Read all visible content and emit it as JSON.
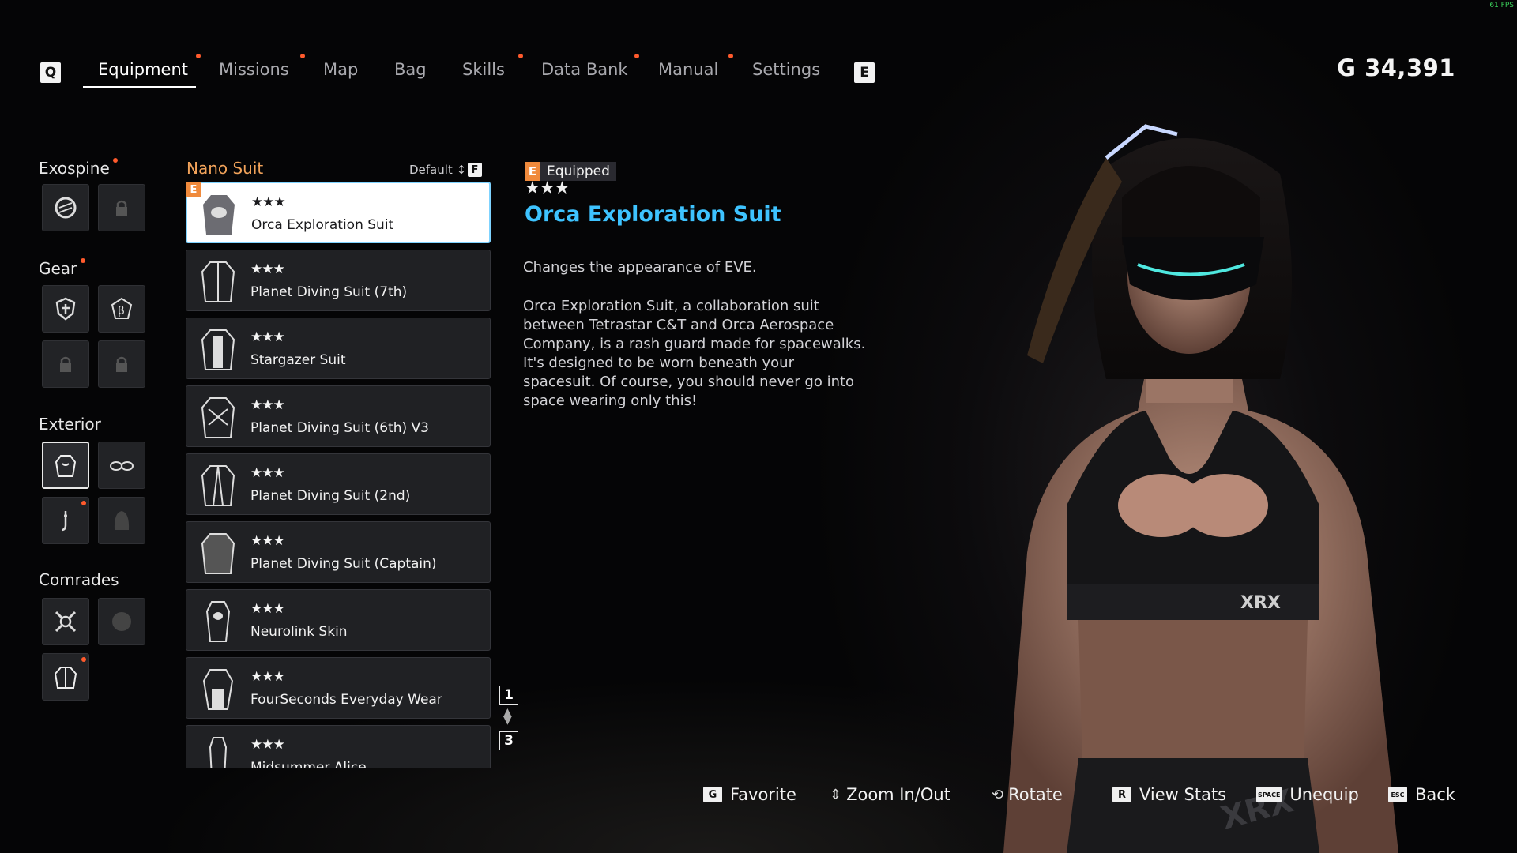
{
  "fps": "61 FPS",
  "nav": {
    "prev_key": "Q",
    "next_key": "E",
    "tabs": [
      {
        "label": "Equipment",
        "active": true,
        "notify": true
      },
      {
        "label": "Missions",
        "notify": true
      },
      {
        "label": "Map"
      },
      {
        "label": "Bag"
      },
      {
        "label": "Skills",
        "notify": true
      },
      {
        "label": "Data Bank",
        "notify": true
      },
      {
        "label": "Manual",
        "notify": true
      },
      {
        "label": "Settings"
      }
    ]
  },
  "currency": {
    "symbol": "G",
    "amount": "34,391"
  },
  "sidebar": {
    "exospine": "Exospine",
    "gear": "Gear",
    "exterior": "Exterior",
    "comrades": "Comrades"
  },
  "list": {
    "title": "Nano Suit",
    "sort_label": "Default",
    "sort_key": "F",
    "equipped_badge": "E",
    "items": [
      {
        "stars": "★★★",
        "name": "Orca Exploration Suit",
        "selected": true,
        "equipped": true
      },
      {
        "stars": "★★★",
        "name": "Planet Diving Suit (7th)"
      },
      {
        "stars": "★★★",
        "name": "Stargazer Suit"
      },
      {
        "stars": "★★★",
        "name": "Planet Diving Suit (6th) V3"
      },
      {
        "stars": "★★★",
        "name": "Planet Diving Suit (2nd)"
      },
      {
        "stars": "★★★",
        "name": "Planet Diving Suit (Captain)"
      },
      {
        "stars": "★★★",
        "name": "Neurolink Skin"
      },
      {
        "stars": "★★★",
        "name": "FourSeconds Everyday Wear"
      },
      {
        "stars": "★★★",
        "name": "Midsummer Alice"
      }
    ]
  },
  "pager": {
    "up": "1",
    "down": "3"
  },
  "detail": {
    "equipped_key": "E",
    "equipped_label": "Equipped",
    "stars": "★★★",
    "name": "Orca Exploration Suit",
    "short": "Changes the appearance of EVE.",
    "description": "Orca Exploration Suit, a collaboration suit between Tetrastar C&T and Orca Aerospace Company, is a rash guard made for spacewalks. It's designed to be worn beneath your spacesuit. Of course, you should never go into space wearing only this!"
  },
  "hints": {
    "favorite_key": "G",
    "favorite": "Favorite",
    "zoom": "Zoom In/Out",
    "rotate": "Rotate",
    "stats_key": "R",
    "stats": "View Stats",
    "unequip_key": "SPACE",
    "unequip": "Unequip",
    "back_key": "ESC",
    "back": "Back"
  },
  "colors": {
    "accent_blue": "#3ec3ff",
    "accent_orange": "#f08a3c",
    "notify": "#ff5a2c"
  }
}
